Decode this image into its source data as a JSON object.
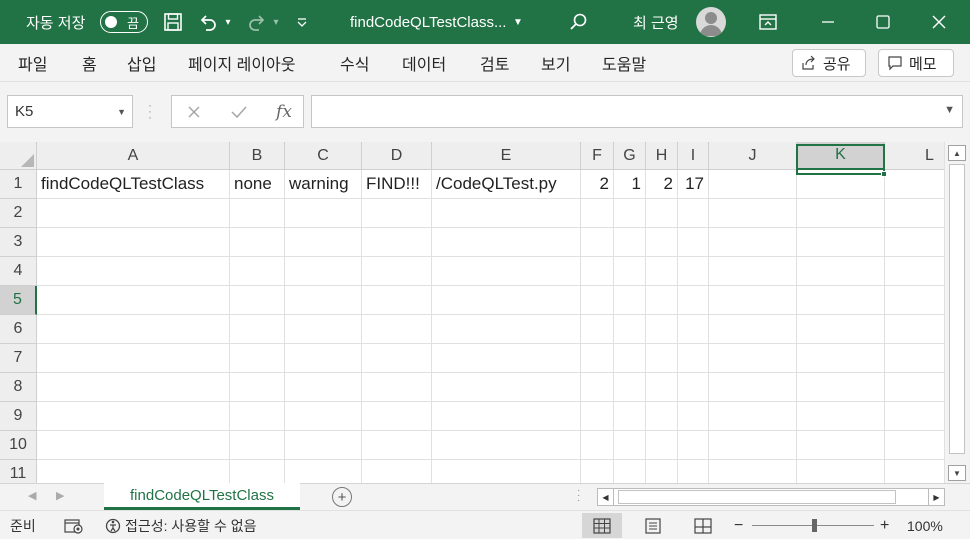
{
  "titlebar": {
    "autosave_label": "자동 저장",
    "autosave_state": "끔",
    "doc_title": "findCodeQLTestClass...",
    "user_name": "최 근영",
    "icons": [
      "save-icon",
      "undo-icon",
      "redo-icon",
      "customize-qat-icon",
      "search-icon",
      "ribbon-display-icon",
      "minimize-icon",
      "maximize-icon",
      "close-icon"
    ],
    "colors": {
      "title_bg": "#217346",
      "title_fg": "#ffffff"
    }
  },
  "ribbon": {
    "tabs": [
      "파일",
      "홈",
      "삽입",
      "페이지 레이아웃",
      "수식",
      "데이터",
      "검토",
      "보기",
      "도움말"
    ],
    "share_label": "공유",
    "memo_label": "메모"
  },
  "formula_bar": {
    "name_box": "K5",
    "fx_label": "fx",
    "value": ""
  },
  "sheet": {
    "columns": [
      "A",
      "B",
      "C",
      "D",
      "E",
      "F",
      "G",
      "H",
      "I",
      "J",
      "K",
      "L"
    ],
    "rows": [
      "1",
      "2",
      "3",
      "4",
      "5",
      "6",
      "7",
      "8",
      "9",
      "10",
      "11"
    ],
    "selected_cell": "K5",
    "row1": {
      "A": "findCodeQLTestClass",
      "B": "none",
      "C": "warning",
      "D": "FIND!!!",
      "E": "/CodeQLTest.py",
      "F": "2",
      "G": "1",
      "H": "2",
      "I": "17"
    }
  },
  "sheet_tabs": {
    "active": "findCodeQLTestClass"
  },
  "status_bar": {
    "ready": "준비",
    "accessibility": "접근성: 사용할 수 없음",
    "zoom": "100%",
    "zoom_minus": "−",
    "zoom_plus": "+"
  }
}
